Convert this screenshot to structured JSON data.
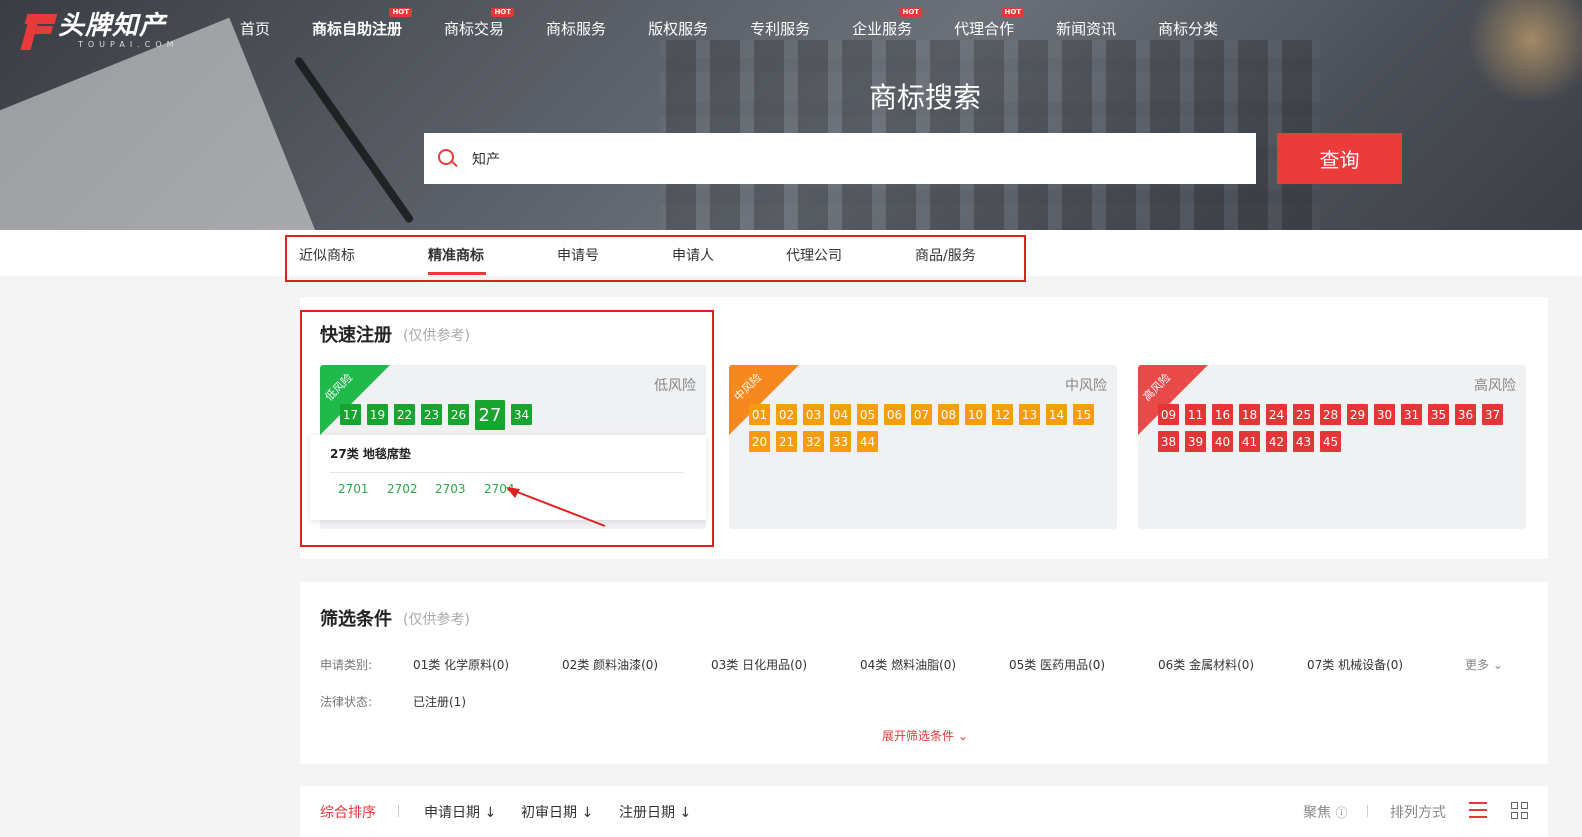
{
  "brand": {
    "name_cn": "头牌知产",
    "name_en": "TOUPAI.COM"
  },
  "nav": [
    {
      "label": "首页",
      "hot": false
    },
    {
      "label": "商标自助注册",
      "hot": true
    },
    {
      "label": "商标交易",
      "hot": true
    },
    {
      "label": "商标服务",
      "hot": false
    },
    {
      "label": "版权服务",
      "hot": false
    },
    {
      "label": "专利服务",
      "hot": false
    },
    {
      "label": "企业服务",
      "hot": true
    },
    {
      "label": "代理合作",
      "hot": true
    },
    {
      "label": "新闻资讯",
      "hot": false
    },
    {
      "label": "商标分类",
      "hot": false
    }
  ],
  "hot_badge": "HOT",
  "hero": {
    "title": "商标搜索"
  },
  "search": {
    "value": "知产",
    "button": "查询"
  },
  "tabs": [
    "近似商标",
    "精准商标",
    "申请号",
    "申请人",
    "代理公司",
    "商品/服务"
  ],
  "active_tab": "精准商标",
  "quick": {
    "title": "快速注册",
    "subtitle": "(仅供参考)",
    "low": {
      "ribbon": "低风险",
      "label": "低风险",
      "color": "#19a32f",
      "classes": [
        "17",
        "19",
        "22",
        "23",
        "26",
        "27",
        "34"
      ],
      "selected": "27"
    },
    "mid": {
      "ribbon": "中风险",
      "label": "中风险",
      "color": "#f59d0c",
      "row1": [
        "01",
        "02",
        "03",
        "04",
        "05",
        "06",
        "07",
        "08",
        "10",
        "12",
        "13",
        "14",
        "15"
      ],
      "row2": [
        "20",
        "21",
        "32",
        "33",
        "44"
      ]
    },
    "high": {
      "ribbon": "高风险",
      "label": "高风险",
      "color": "#e33636",
      "row1": [
        "09",
        "11",
        "16",
        "18",
        "24",
        "25",
        "28",
        "29",
        "30",
        "31",
        "35",
        "36",
        "37"
      ],
      "row2": [
        "38",
        "39",
        "40",
        "41",
        "42",
        "43",
        "45"
      ]
    },
    "popup": {
      "title": "27类 地毯席垫",
      "subclasses": [
        "2701",
        "2702",
        "2703",
        "2704"
      ]
    }
  },
  "filters": {
    "title": "筛选条件",
    "subtitle": "(仅供参考)",
    "category_label": "申请类别:",
    "categories": [
      "01类 化学原料(0)",
      "02类 颜料油漆(0)",
      "03类 日化用品(0)",
      "04类 燃料油脂(0)",
      "05类 医药用品(0)",
      "06类 金属材料(0)",
      "07类 机械设备(0)"
    ],
    "more": "更多",
    "status_label": "法律状态:",
    "statuses": [
      "已注册(1)"
    ],
    "expand": "展开筛选条件"
  },
  "sort": {
    "items": [
      "综合排序",
      "申请日期",
      "初审日期",
      "注册日期"
    ],
    "active": "综合排序",
    "focus": "聚焦",
    "layout_label": "排列方式"
  }
}
